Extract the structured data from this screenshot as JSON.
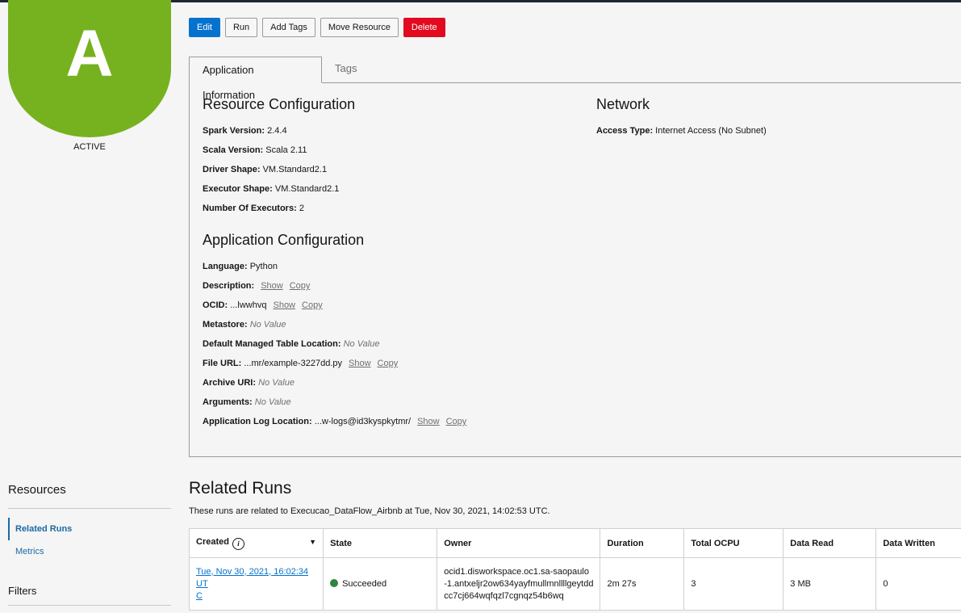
{
  "app": {
    "avatar_letter": "A",
    "status": "ACTIVE",
    "accent": "#76b21f"
  },
  "toolbar": {
    "edit": "Edit",
    "run": "Run",
    "add_tags": "Add Tags",
    "move_resource": "Move Resource",
    "delete": "Delete"
  },
  "tabs": {
    "app_info": "Application Information",
    "tags": "Tags"
  },
  "resource_config": {
    "title": "Resource Configuration",
    "spark_version_label": "Spark Version:",
    "spark_version": "2.4.4",
    "scala_version_label": "Scala Version:",
    "scala_version": "Scala 2.11",
    "driver_shape_label": "Driver Shape:",
    "driver_shape": "VM.Standard2.1",
    "executor_shape_label": "Executor Shape:",
    "executor_shape": "VM.Standard2.1",
    "num_executors_label": "Number Of Executors:",
    "num_executors": "2"
  },
  "network": {
    "title": "Network",
    "access_type_label": "Access Type:",
    "access_type": "Internet Access (No Subnet)"
  },
  "app_config": {
    "title": "Application Configuration",
    "language_label": "Language:",
    "language": "Python",
    "description_label": "Description:",
    "ocid_label": "OCID:",
    "ocid": "...lwwhvq",
    "metastore_label": "Metastore:",
    "default_table_label": "Default Managed Table Location:",
    "file_url_label": "File URL:",
    "file_url": "...mr/example-3227dd.py",
    "archive_uri_label": "Archive URI:",
    "arguments_label": "Arguments:",
    "log_location_label": "Application Log Location:",
    "log_location": "...w-logs@id3kyspkytmr/",
    "no_value": "No Value",
    "show": "Show",
    "copy": "Copy"
  },
  "resources": {
    "title": "Resources",
    "items": [
      "Related Runs",
      "Metrics"
    ],
    "filters": "Filters"
  },
  "related_runs": {
    "title": "Related Runs",
    "description": "These runs are related to Execucao_DataFlow_Airbnb at Tue, Nov 30, 2021, 14:02:53 UTC.",
    "columns": [
      "Created",
      "State",
      "Owner",
      "Duration",
      "Total OCPU",
      "Data Read",
      "Data Written"
    ],
    "rows": [
      {
        "created_1": "Tue, Nov 30, 2021, 16:02:34 UT",
        "created_2": "C",
        "state": "Succeeded",
        "owner_1": "ocid1.disworkspace.oc1.sa-saopaulo",
        "owner_2": "-1.antxeljr2ow634yayfmullmnllllgeytdd",
        "owner_3": "cc7cj664wqfqzl7cgnqz54b6wq",
        "duration": "2m 27s",
        "total_ocpu": "3",
        "data_read": "3 MB",
        "data_written": "0"
      }
    ]
  }
}
